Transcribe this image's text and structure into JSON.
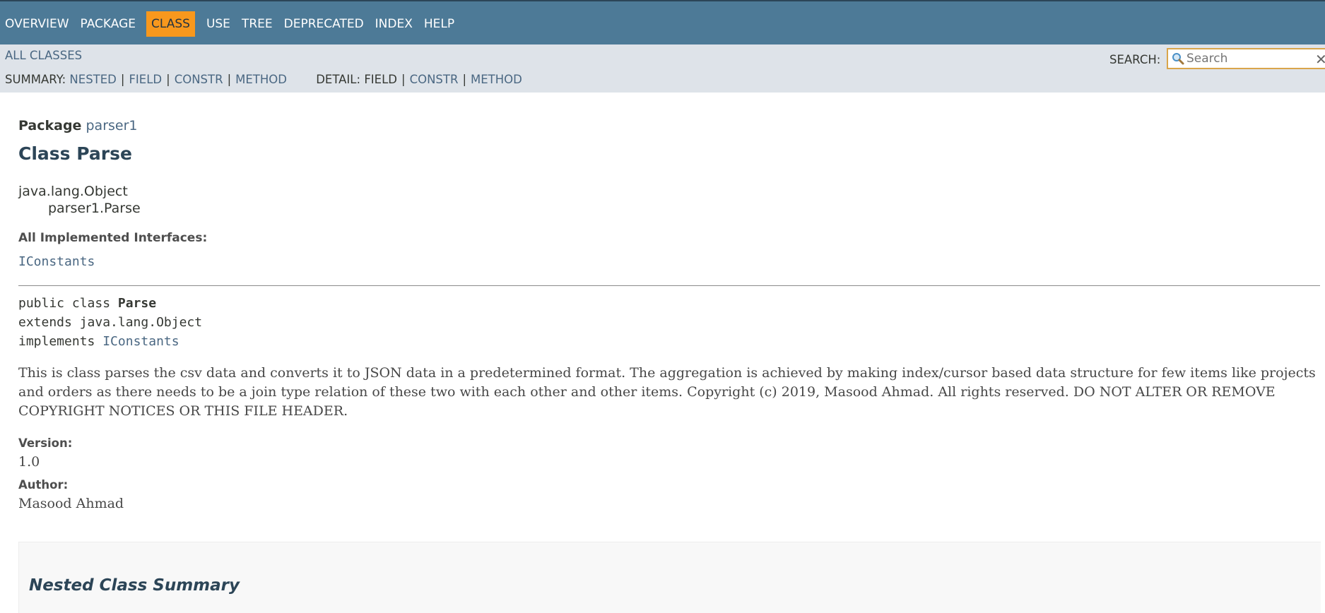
{
  "topnav": {
    "items": [
      "OVERVIEW",
      "PACKAGE",
      "CLASS",
      "USE",
      "TREE",
      "DEPRECATED",
      "INDEX",
      "HELP"
    ],
    "active": "CLASS"
  },
  "subnav": {
    "all_classes": "ALL CLASSES",
    "summary_label": "SUMMARY:",
    "summary_links": [
      "NESTED",
      "FIELD",
      "CONSTR",
      "METHOD"
    ],
    "detail_label": "DETAIL:",
    "detail_field": "FIELD",
    "detail_links": [
      "CONSTR",
      "METHOD"
    ],
    "search_label": "SEARCH:",
    "search_placeholder": "Search"
  },
  "header": {
    "package_label": "Package",
    "package_name": "parser1",
    "class_title": "Class Parse"
  },
  "inheritance": {
    "parent": "java.lang.Object",
    "child": "parser1.Parse"
  },
  "interfaces": {
    "label": "All Implemented Interfaces:",
    "items": [
      "IConstants"
    ]
  },
  "signature": {
    "line1_prefix": "public class ",
    "class_name": "Parse",
    "line2": "extends java.lang.Object",
    "line3_prefix": "implements ",
    "implements": "IConstants"
  },
  "description": "This is class parses the csv data and converts it to JSON data in a predetermined format. The aggregation is achieved by making index/cursor based data structure for few items like projects and orders as there needs to be a join type relation of these two with each other and other items. Copyright (c) 2019, Masood Ahmad. All rights reserved. DO NOT ALTER OR REMOVE COPYRIGHT NOTICES OR THIS FILE HEADER.",
  "tags": {
    "version_label": "Version:",
    "version_value": "1.0",
    "author_label": "Author:",
    "author_value": "Masood Ahmad"
  },
  "sections": {
    "nested_summary_title": "Nested Class Summary"
  },
  "colors": {
    "nav_bg": "#4d7a97",
    "nav_active": "#f8981d",
    "subnav_bg": "#dee3e9",
    "link": "#4a6782",
    "heading": "#2c4557"
  }
}
